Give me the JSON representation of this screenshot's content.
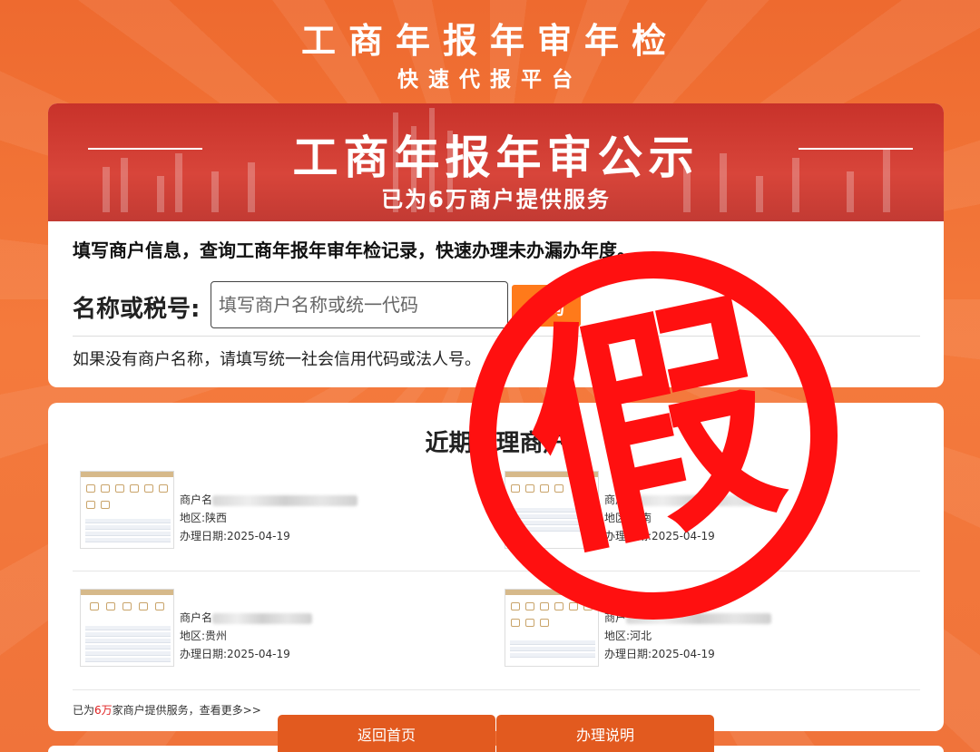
{
  "header": {
    "title": "工商年报年审年检",
    "subtitle": "快速代报平台"
  },
  "banner": {
    "title": "工商年报年审公示",
    "subtitle": "已为6万商户提供服务"
  },
  "query": {
    "intro": "填写商户信息，查询工商年报年审年检记录，快速办理未办漏办年度。",
    "label": "名称或税号:",
    "placeholder": "填写商户名称或统一代码",
    "button_label": "查询",
    "hint": "如果没有商户名称，请填写统一社会信用代码或法人号。"
  },
  "recent": {
    "title": "近期办理商户",
    "merchants": [
      {
        "name_label": "商户名",
        "region": "地区:陕西",
        "date": "办理日期:2025-04-19"
      },
      {
        "name_label": "商户",
        "region": "地区:湖南",
        "date": "办理日期:2025-04-19"
      },
      {
        "name_label": "商户名",
        "region": "地区:贵州",
        "date": "办理日期:2025-04-19"
      },
      {
        "name_label": "商户",
        "region": "地区:河北",
        "date": "办理日期:2025-04-19"
      }
    ],
    "served_prefix": "已为",
    "served_count": "6万",
    "served_suffix": "家商户提供服务，查看更多>>"
  },
  "nav": {
    "home_label": "返回首页",
    "guide_label": "办理说明"
  },
  "stamp": {
    "text": "假",
    "color": "#ff1010"
  },
  "colors": {
    "accent": "#ff7a1a",
    "banner_red": "#c8322a",
    "button_orange": "#e25a1f"
  }
}
